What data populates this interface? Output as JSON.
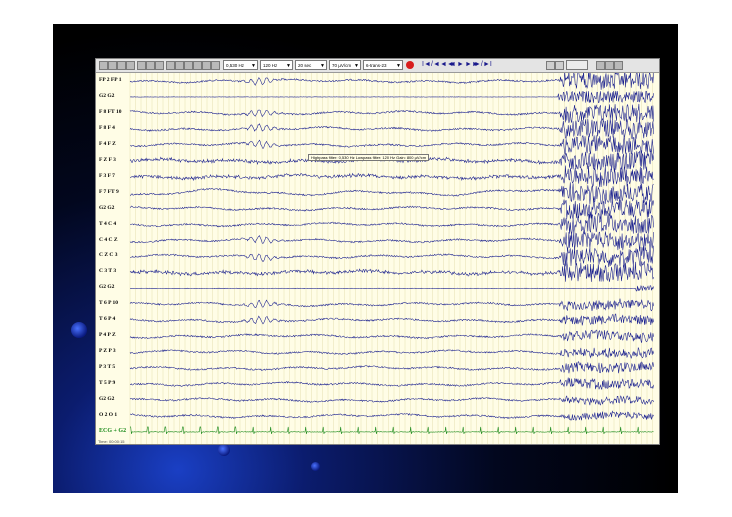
{
  "toolbar": {
    "highpass": "0,530 Hz",
    "lowpass": "120 Hz",
    "sensitivity": "20 sec",
    "gain": "70 µV/cm",
    "montage": "6-trans-23",
    "nav_symbols": [
      "I◄",
      "/◄",
      "◄◄",
      "◄",
      "►",
      "►►",
      "►/",
      "►I"
    ]
  },
  "channels": [
    "FP 2 FP 1",
    "G2 G2",
    "F 8 FT 10",
    "F 8 F 4",
    "F 4 F Z",
    "F Z F 3",
    "F 3 F 7",
    "F 7 FT 9",
    "G2 G2",
    "T 4 C 4",
    "C 4 C Z",
    "C Z C 3",
    "C 3 T 3",
    "G2 G2",
    "T 6 P 10",
    "T 6 P 4",
    "P 4 P Z",
    "P Z P 3",
    "P 3 T 5",
    "T 5 P 9",
    "G2 G2",
    "O 2 O 1",
    "ECG + G2"
  ],
  "tooltip": "Highpass filter: 0,530 Hz   Lowpass filter: 120 Hz   Gain: 800 µV/cm",
  "footer": "Time: 00:00:15",
  "colors": {
    "trace": "#141a8c",
    "ecg": "#1a8a1a",
    "background": "#fffde6",
    "gridline": "#e6dfb0"
  }
}
